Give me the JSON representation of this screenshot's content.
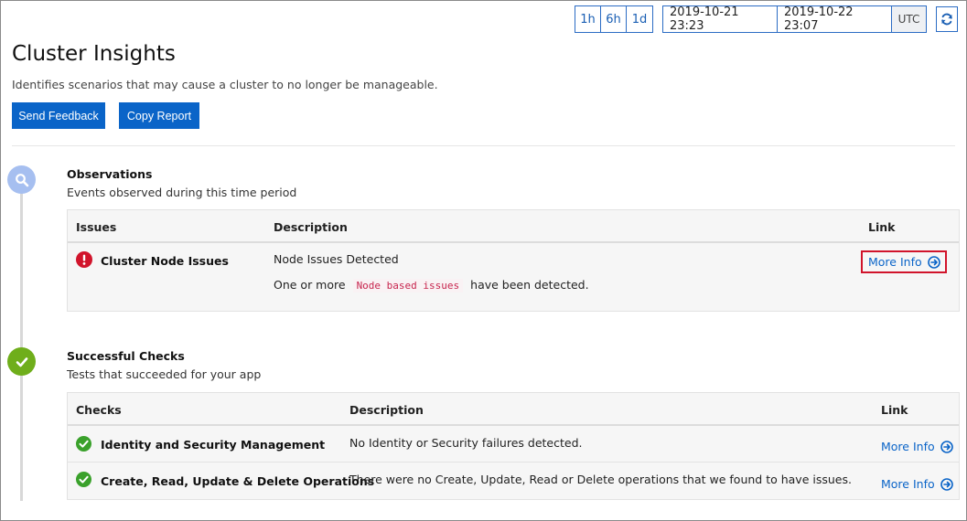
{
  "timebar": {
    "ranges": [
      "1h",
      "6h",
      "1d"
    ],
    "start": "2019-10-21 23:23",
    "end": "2019-10-22 23:07",
    "timezone": "UTC"
  },
  "page": {
    "title": "Cluster Insights",
    "subtitle": "Identifies scenarios that may cause a cluster to no longer be manageable."
  },
  "actions": {
    "send_feedback": "Send Feedback",
    "copy_report": "Copy Report"
  },
  "observations": {
    "heading": "Observations",
    "subheading": "Events observed during this time period",
    "columns": {
      "issues": "Issues",
      "description": "Description",
      "link": "Link"
    },
    "rows": [
      {
        "name": "Cluster Node Issues",
        "title": "Node Issues Detected",
        "desc_prefix": "One or more",
        "desc_code": "Node based issues",
        "desc_suffix": "have been detected.",
        "link": "More Info"
      }
    ]
  },
  "checks": {
    "heading": "Successful Checks",
    "subheading": "Tests that succeeded for your app",
    "columns": {
      "checks": "Checks",
      "description": "Description",
      "link": "Link"
    },
    "rows": [
      {
        "name": "Identity and Security Management",
        "description": "No Identity or Security failures detected.",
        "link": "More Info"
      },
      {
        "name": "Create, Read, Update & Delete Operations",
        "description": "There were no Create, Update, Read or Delete operations that we found to have issues.",
        "link": "More Info"
      }
    ]
  },
  "colors": {
    "accent": "#0a64c8",
    "error": "#d1142b",
    "success": "#3aa12b",
    "observation_marker": "#a6bff0",
    "success_marker": "#6fae1b"
  },
  "icons": {
    "observation_marker": "search-icon",
    "success_marker": "checkmark-icon",
    "issue": "error-icon",
    "check": "success-check-icon",
    "link": "arrow-circle-right-icon",
    "refresh": "refresh-icon"
  }
}
